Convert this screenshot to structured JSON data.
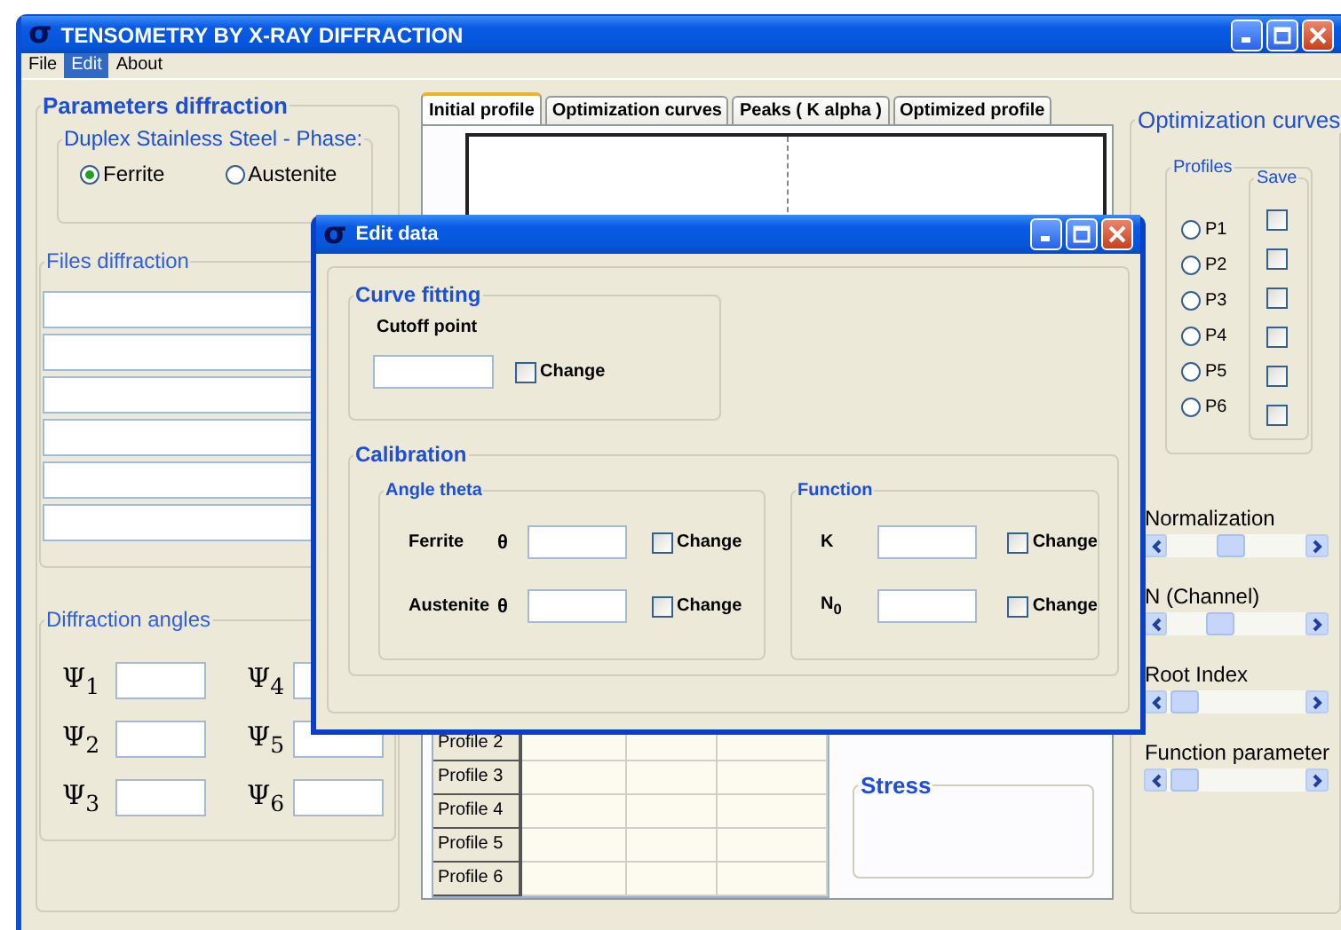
{
  "window": {
    "logo": "σ",
    "title": "TENSOMETRY BY X-RAY DIFFRACTION"
  },
  "menu": [
    {
      "label": "File",
      "selected": false
    },
    {
      "label": "Edit",
      "selected": true
    },
    {
      "label": "About",
      "selected": false
    }
  ],
  "parameters": {
    "title": "Parameters diffraction",
    "phase": {
      "title": "Duplex Stainless Steel -  Phase:",
      "options": [
        {
          "label": "Ferrite",
          "selected": true
        },
        {
          "label": "Austenite",
          "selected": false
        }
      ]
    }
  },
  "files": {
    "title": "Files diffraction",
    "fields": [
      {
        "kind": "file"
      },
      {
        "kind": "file"
      },
      {
        "kind": "file"
      },
      {
        "kind": "file"
      },
      {
        "kind": "file"
      },
      {
        "kind": "file"
      }
    ]
  },
  "angles": {
    "title": "Diffraction angles",
    "items": [
      {
        "label": "Ψ$_{1}$"
      },
      {
        "label": "Ψ$_{4}$"
      },
      {
        "label": "Ψ$_{2}$"
      },
      {
        "label": "Ψ$_{5}$"
      },
      {
        "label": "Ψ$_{3}$"
      },
      {
        "label": "Ψ$_{6}$"
      }
    ]
  },
  "tabs": [
    {
      "label": "Initial profile",
      "selected": true
    },
    {
      "label": "Optimization curves",
      "selected": false
    },
    {
      "label": "Peaks ( K alpha )",
      "selected": false
    },
    {
      "label": "Optimized profile",
      "selected": false
    }
  ],
  "table": {
    "rows": [
      "Profile 2",
      "Profile 3",
      "Profile 4",
      "Profile 5",
      "Profile 6"
    ]
  },
  "stress": {
    "title": "Stress"
  },
  "optimization": {
    "title": "Optimization curves",
    "profiles_title": "Profiles",
    "save_title": "Save",
    "profiles": [
      {
        "label": "P1",
        "selected": false,
        "saved": false
      },
      {
        "label": "P2",
        "selected": false,
        "saved": false
      },
      {
        "label": "P3",
        "selected": false,
        "saved": false
      },
      {
        "label": "P4",
        "selected": false,
        "saved": false
      },
      {
        "label": "P5",
        "selected": false,
        "saved": false
      },
      {
        "label": "P6",
        "selected": false,
        "saved": false
      }
    ],
    "sliders": [
      {
        "label": "Normalization",
        "level": 0.45
      },
      {
        "label": "N (Channel)",
        "level": 0.35
      },
      {
        "label": "Root Index",
        "level": 0.03
      },
      {
        "label": "Function parameter",
        "level": 0.03
      }
    ]
  },
  "dialog": {
    "logo": "σ",
    "title": "Edit data",
    "curve_fitting": {
      "title": "Curve fitting",
      "label": "Cutoff point",
      "change": {
        "label": "Change",
        "checked": false
      }
    },
    "calibration": {
      "title": "Calibration",
      "groups": [
        {
          "title": "Angle theta",
          "rows": [
            {
              "label": "Ferrite",
              "symbol": "θ",
              "change": "Change",
              "checked": false
            },
            {
              "label": "Austenite",
              "symbol": "θ",
              "change": "Change",
              "checked": false
            }
          ]
        },
        {
          "title": "Function",
          "rows": [
            {
              "label": "K",
              "change": "Change",
              "checked": false
            },
            {
              "label": "N$_{0}$",
              "change": "Change",
              "checked": false
            }
          ]
        }
      ]
    }
  }
}
